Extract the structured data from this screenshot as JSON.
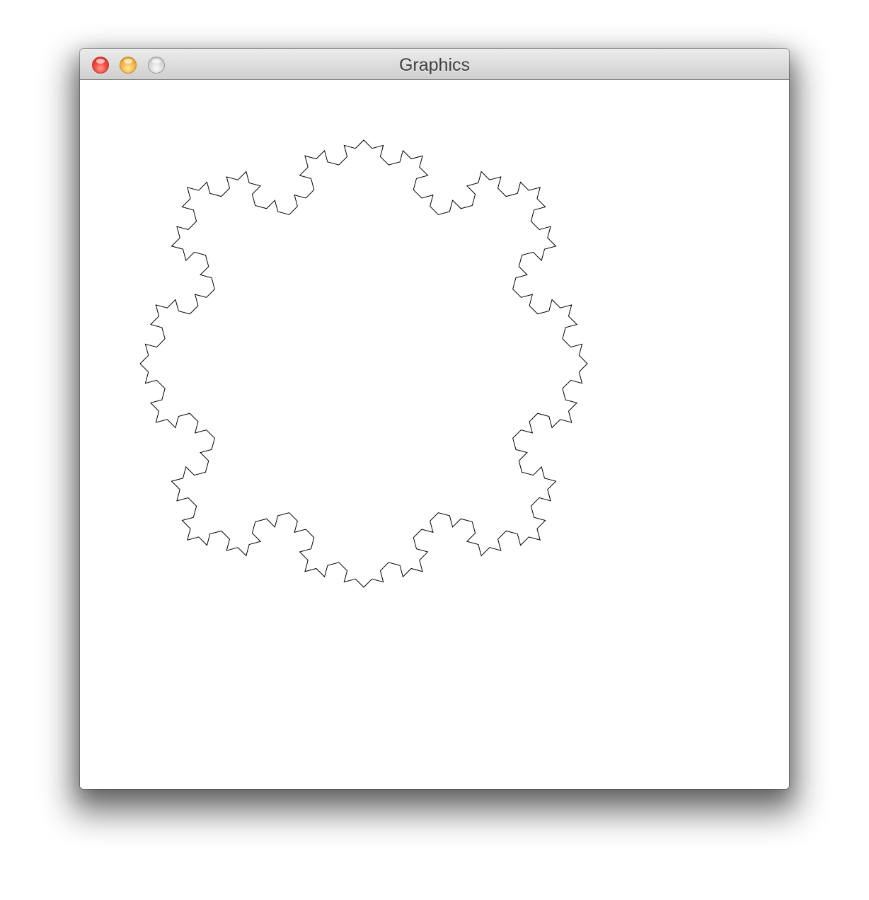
{
  "window": {
    "title": "Graphics",
    "controls": {
      "close_icon": "close-icon",
      "minimize_icon": "minimize-icon",
      "zoom_icon": "zoom-icon"
    }
  },
  "canvas": {
    "background": "#ffffff",
    "stroke": "#000000",
    "shape": "koch-quadric-snowflake",
    "depth": 3,
    "base_shape": "square"
  }
}
